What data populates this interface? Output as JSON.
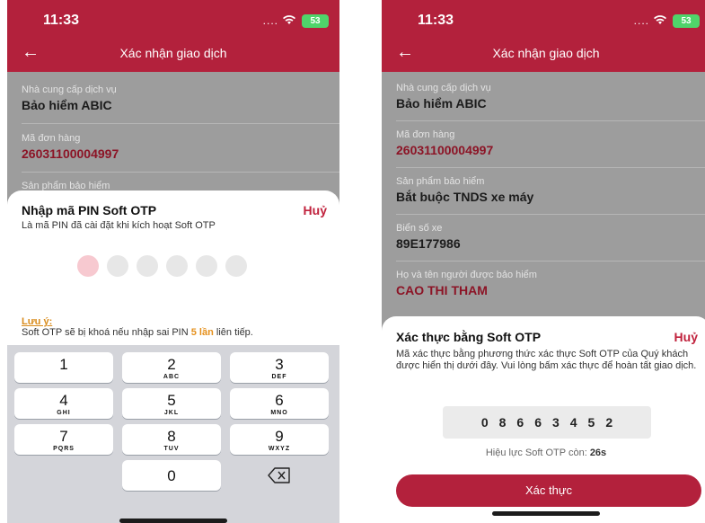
{
  "status": {
    "time": "11:33",
    "signal": "....",
    "battery": "53"
  },
  "left": {
    "title": "Xác nhận giao dịch",
    "fields": [
      {
        "label": "Nhà cung cấp dịch vụ",
        "value": "Bảo hiểm ABIC"
      },
      {
        "label": "Mã đơn hàng",
        "value": "26031100004997"
      },
      {
        "label": "Sản phẩm bảo hiểm"
      }
    ],
    "sheet": {
      "title": "Nhập mã PIN Soft OTP",
      "cancel": "Huỷ",
      "subtitle": "Là mã PIN đã cài đặt khi kích hoạt Soft OTP",
      "pins_entered": 1,
      "pins_total": 6,
      "note_title": "Lưu ý:",
      "note_pre": "Soft OTP sẽ bị khoá nếu nhập sai PIN ",
      "note_hl": "5 lần",
      "note_post": " liên tiếp."
    },
    "keypad": [
      {
        "num": "1",
        "letters": ""
      },
      {
        "num": "2",
        "letters": "ABC"
      },
      {
        "num": "3",
        "letters": "DEF"
      },
      {
        "num": "4",
        "letters": "GHI"
      },
      {
        "num": "5",
        "letters": "JKL"
      },
      {
        "num": "6",
        "letters": "MNO"
      },
      {
        "num": "7",
        "letters": "PQRS"
      },
      {
        "num": "8",
        "letters": "TUV"
      },
      {
        "num": "9",
        "letters": "WXYZ"
      },
      {
        "num": "0",
        "letters": ""
      }
    ]
  },
  "right": {
    "title": "Xác nhận giao dịch",
    "fields": [
      {
        "label": "Nhà cung cấp dịch vụ",
        "value": "Bảo hiểm ABIC"
      },
      {
        "label": "Mã đơn hàng",
        "value": "26031100004997"
      },
      {
        "label": "Sản phẩm bảo hiểm",
        "value": "Bắt buộc TNDS xe máy"
      },
      {
        "label": "Biển số xe",
        "value": "89E177986"
      },
      {
        "label": "Họ và tên người được bảo hiểm",
        "value": "CAO THI THAM"
      }
    ],
    "sheet": {
      "title": "Xác thực bằng Soft OTP",
      "cancel": "Huỷ",
      "desc": "Mã xác thực bằng phương thức xác thực Soft OTP của Quý khách được hiển thị dưới đây. Vui lòng bấm xác thực để hoàn tất giao dịch.",
      "otp": "08663452",
      "validity_label": "Hiệu lực Soft OTP còn: ",
      "validity_value": "26s",
      "confirm": "Xác thực"
    }
  },
  "colors": {
    "brand": "#b3213c",
    "accent": "#e5901c"
  },
  "icons": {
    "back": "arrow-left-icon",
    "wifi": "wifi-icon",
    "delete": "backspace-icon"
  }
}
